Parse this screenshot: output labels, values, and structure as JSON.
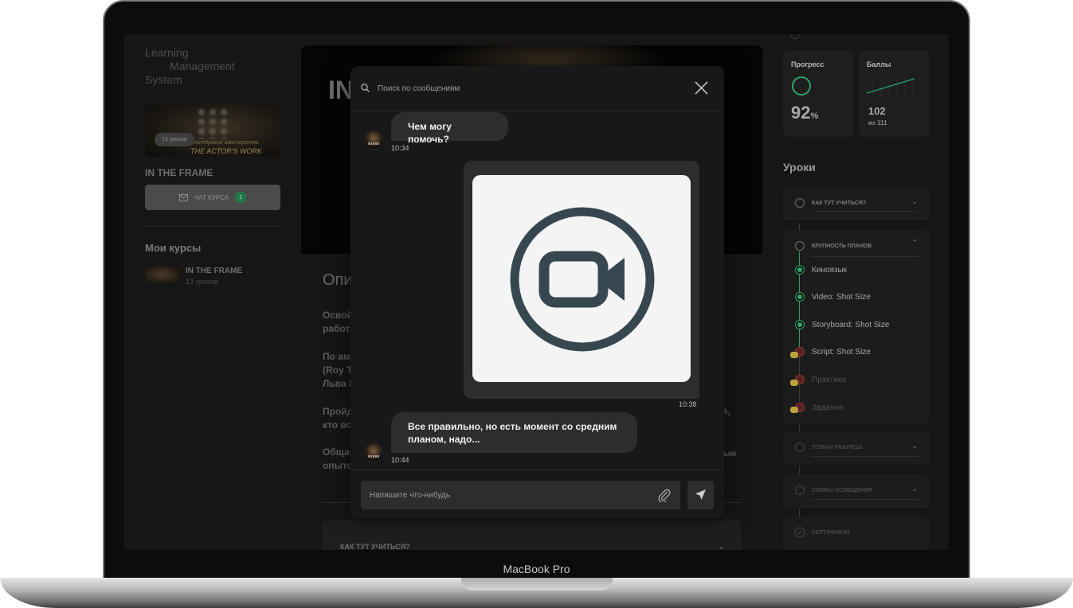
{
  "device": {
    "label": "MacBook Pro"
  },
  "app": {
    "logo": [
      "Learning",
      "Management",
      "System"
    ],
    "sidebar": {
      "course_card": {
        "pill": "13 уроков",
        "title_line1": "Актёрское мастерство",
        "title_line2": "THE ACTOR'S WORK"
      },
      "course_name": "IN THE FRAME",
      "chat_button": {
        "label": "ЧАТ КУРСА",
        "badge": "1"
      },
      "my_courses_title": "Мои курсы",
      "my_courses": [
        {
          "title": "IN THE FRAME",
          "subtitle": "13 уроков"
        }
      ]
    },
    "main": {
      "hero_title": "IN",
      "description_title": "Опи",
      "lines": [
        "Освой",
        "работ",
        "По ам",
        "(Roy T",
        "Льва К",
        "Пройд",
        "кто вс",
        "Общая",
        "опыто",
        "й,",
        "ым"
      ],
      "accordion": {
        "label": "КАК ТУТ УЧИТЬСЯ?",
        "chevron": "⌄"
      }
    },
    "right": {
      "progress": {
        "label": "Прогресс",
        "value": "92",
        "unit": "%",
        "fraction": 0.92
      },
      "score": {
        "label": "Баллы",
        "value": "102",
        "of": "из 111"
      },
      "lessons_title": "Уроки",
      "sections": [
        {
          "title": "КАК ТУТ УЧИТЬСЯ?",
          "expanded": false
        },
        {
          "title": "КРУПНОСТЬ ПЛАНОВ",
          "expanded": true,
          "items": [
            {
              "title": "Киноязык",
              "status": "done"
            },
            {
              "title": "Video: Shot Size",
              "status": "done"
            },
            {
              "title": "Storyboard: Shot Size",
              "status": "done"
            },
            {
              "title": "Script: Shot Size",
              "status": "locked"
            },
            {
              "title": "Практика",
              "status": "locked"
            },
            {
              "title": "Задание",
              "status": "locked"
            }
          ]
        },
        {
          "title": "УГЛЫ И РАКУРСЫ",
          "expanded": false
        },
        {
          "title": "СХЕМЫ ОСВЕЩЕНИЯ",
          "expanded": false
        },
        {
          "title": "СЕРТИФИКАТ",
          "expanded": false
        }
      ]
    },
    "chat": {
      "search_placeholder": "Поиск по сообщениям",
      "messages": [
        {
          "text": "Чем могу помочь?",
          "time": "10:34",
          "from": "tutor"
        },
        {
          "type": "video",
          "time": "10:38",
          "from": "me"
        },
        {
          "text": "Все правильно, но есть момент со средним планом, надо...",
          "time": "10:44",
          "from": "tutor"
        }
      ],
      "composer_placeholder": "Напишите что-нибудь"
    }
  },
  "colors": {
    "accent_green": "#2fa36b",
    "video_icon": "#37474f",
    "bubble": "#2d2d2d",
    "modal_bg": "#181818"
  },
  "icons": {
    "search": "search-icon",
    "close": "close-icon",
    "attach": "paperclip-icon",
    "send": "send-icon",
    "video": "video-camera-icon",
    "mail": "mail-icon"
  }
}
